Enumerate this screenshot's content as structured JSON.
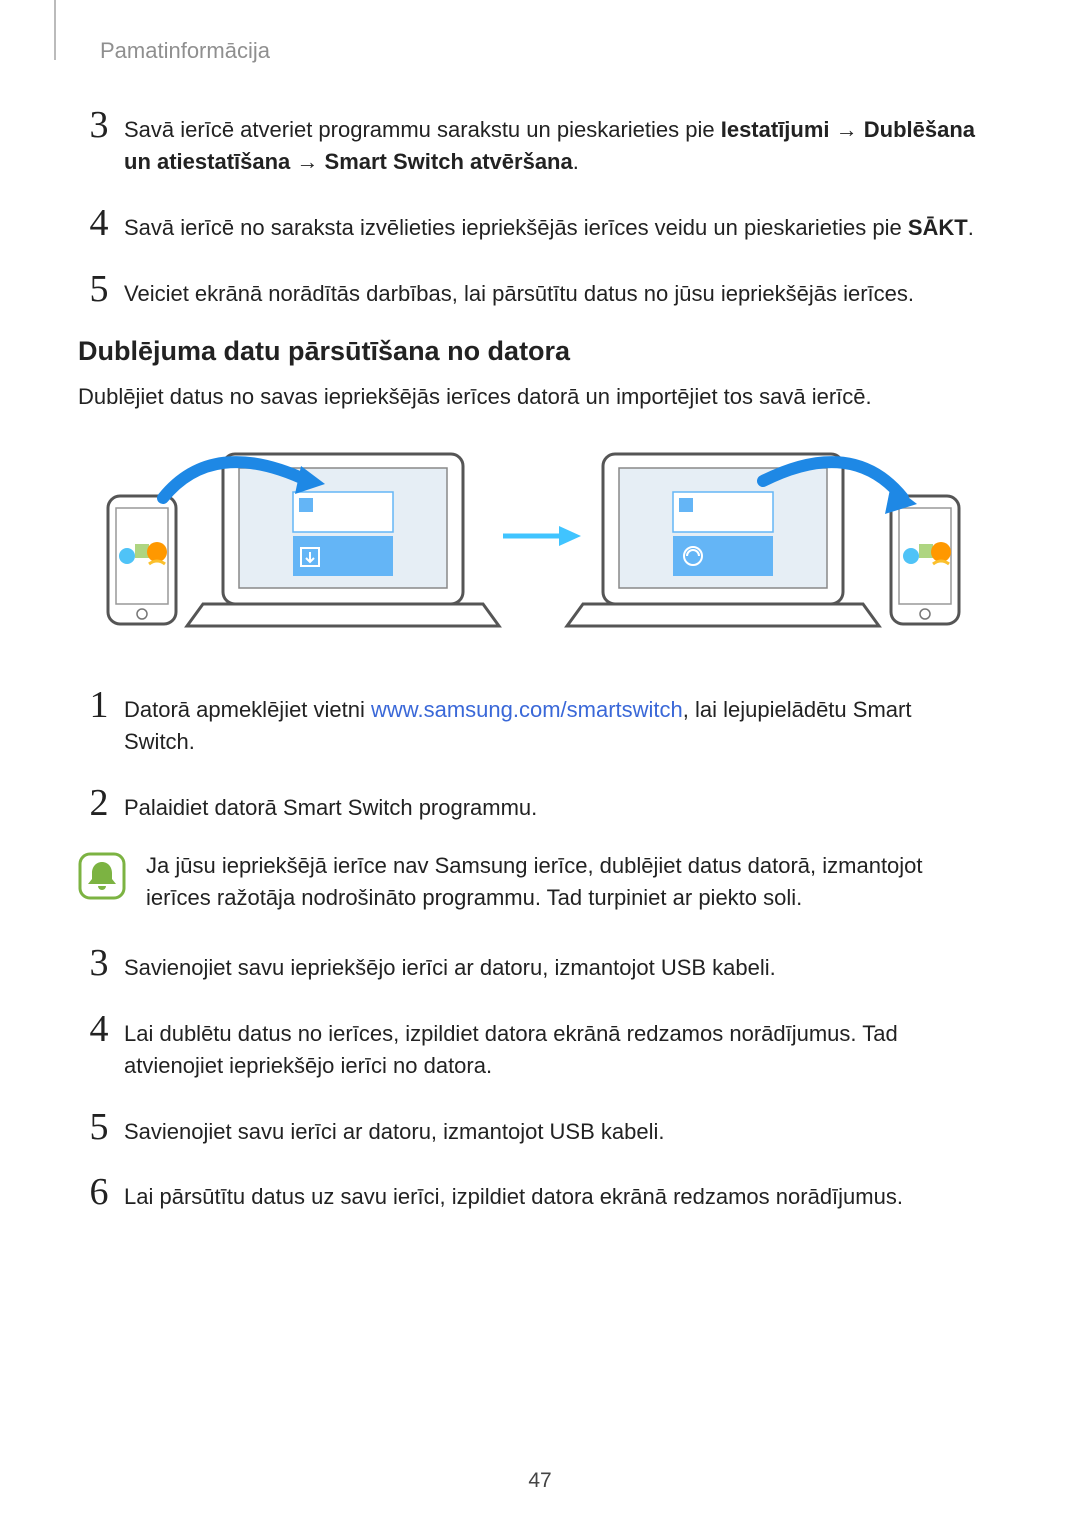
{
  "breadcrumb": "Pamatinformācija",
  "topSteps": {
    "s3": {
      "num": "3",
      "prefix": "Savā ierīcē atveriet programmu sarakstu un pieskarieties pie ",
      "b1": "Iestatījumi",
      "arrow1": " → ",
      "b2": "Dublēšana un atiestatīšana",
      "arrow2": " → ",
      "b3": "Smart Switch atvēršana",
      "suffix": "."
    },
    "s4": {
      "num": "4",
      "prefix": "Savā ierīcē no saraksta izvēlieties iepriekšējās ierīces veidu un pieskarieties pie ",
      "b1": "SĀKT",
      "suffix": "."
    },
    "s5": {
      "num": "5",
      "text": "Veiciet ekrānā norādītās darbības, lai pārsūtītu datus no jūsu iepriekšējās ierīces."
    }
  },
  "subheading": "Dublējuma datu pārsūtīšana no datora",
  "para1": "Dublējiet datus no savas iepriekšējās ierīces datorā un importējiet tos savā ierīcē.",
  "bottomSteps": {
    "s1": {
      "num": "1",
      "prefix": "Datorā apmeklējiet vietni ",
      "link": "www.samsung.com/smartswitch",
      "suffix": ", lai lejupielādētu Smart Switch."
    },
    "s2": {
      "num": "2",
      "text": "Palaidiet datorā Smart Switch programmu."
    },
    "s3": {
      "num": "3",
      "text": "Savienojiet savu iepriekšējo ierīci ar datoru, izmantojot USB kabeli."
    },
    "s4": {
      "num": "4",
      "text": "Lai dublētu datus no ierīces, izpildiet datora ekrānā redzamos norādījumus. Tad atvienojiet iepriekšējo ierīci no datora."
    },
    "s5": {
      "num": "5",
      "text": "Savienojiet savu ierīci ar datoru, izmantojot USB kabeli."
    },
    "s6": {
      "num": "6",
      "text": "Lai pārsūtītu datus uz savu ierīci, izpildiet datora ekrānā redzamos norādījumus."
    }
  },
  "note": "Ja jūsu iepriekšējā ierīce nav Samsung ierīce, dublējiet datus datorā, izmantojot ierīces ražotāja nodrošināto programmu. Tad turpiniet ar piekto soli.",
  "pageNumber": "47"
}
